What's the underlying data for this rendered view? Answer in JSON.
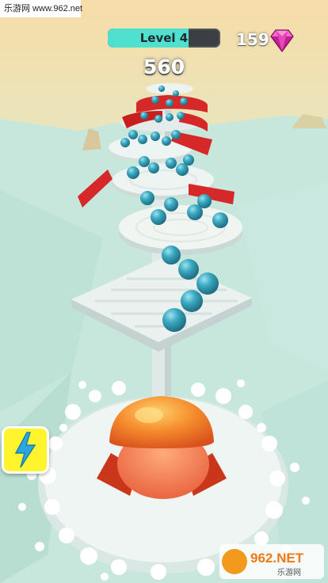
{
  "watermark_top": "乐游网 www.962.net",
  "hud": {
    "level_label": "Level 4",
    "level_progress": 0.72,
    "gem_count": "159",
    "score": "560"
  },
  "watermark_logo": {
    "brand": "962.NET",
    "subtitle": "乐游网"
  },
  "colors": {
    "ball": "#2f9fb7",
    "hazard": "#d62828",
    "player": "#f05a28",
    "accent": "#4fe0cf",
    "boost": "#fff42e"
  },
  "icons": {
    "gem": "gem-icon",
    "boost": "lightning-bolt-icon"
  }
}
